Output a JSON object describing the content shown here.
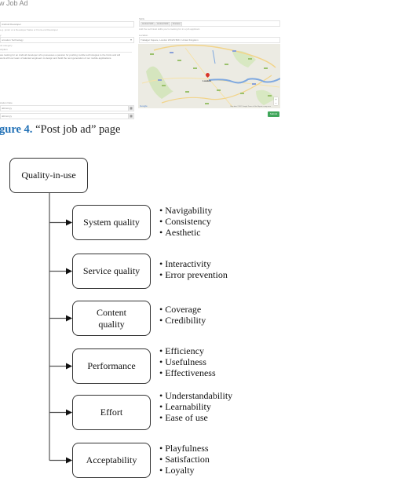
{
  "figure_screenshot": {
    "page_title": "w Job Ad",
    "left_column": {
      "job_title_value": "Android Developer",
      "job_title_help": "e.g. junior or a Developer Sales or Front-end Developer",
      "category_label": "y",
      "category_value": "ormation Technology",
      "category_help": "ob category",
      "description_label": "cription",
      "description_text": "are looking for an Android developer who possesses a passion for pushing mobile technologies to the limits and will work with our team of talented engineers to design and build the next generation of our mobile applications.",
      "date_label": "ication Date",
      "date_from_placeholder": "dd/mm/yy",
      "date_to_placeholder": "dd/mm/yy"
    },
    "right_column": {
      "skills_label": "Skills",
      "skills_tags": [
        "Android SDK",
        "Android NDK",
        "Firebase"
      ],
      "skills_help": "Add the technical skills you're looking for in a job applicant",
      "location_label": "Location",
      "location_value": "Trafalgar Square, London WC2N 5DN, United Kingdom",
      "map": {
        "city_label": "London",
        "zoom_in": "+",
        "zoom_out": "−",
        "google_label": "Google",
        "attribution": "Map data ©2017 Google  Terms of Use  Report a map error"
      }
    },
    "submit_label": "Submit",
    "colors": {
      "submit": "#3fa65a",
      "pin": "#d9352a",
      "river": "#7ea8e0"
    }
  },
  "caption": {
    "number": "gure 4.",
    "text": "“Post job ad” page"
  },
  "diagram": {
    "root": "Quality-in-use",
    "children": [
      {
        "label": "System quality",
        "items": [
          "Navigability",
          "Consistency",
          "Aesthetic"
        ]
      },
      {
        "label": "Service quality",
        "items": [
          "Interactivity",
          "Error prevention"
        ]
      },
      {
        "label": "Content quality",
        "items": [
          "Coverage",
          "Credibility"
        ]
      },
      {
        "label": "Performance",
        "items": [
          "Efficiency",
          "Usefulness",
          "Effectiveness"
        ]
      },
      {
        "label": "Effort",
        "items": [
          "Understandability",
          "Learnability",
          "Ease of use"
        ]
      },
      {
        "label": "Acceptability",
        "items": [
          "Playfulness",
          "Satisfaction",
          "Loyalty"
        ]
      }
    ]
  }
}
